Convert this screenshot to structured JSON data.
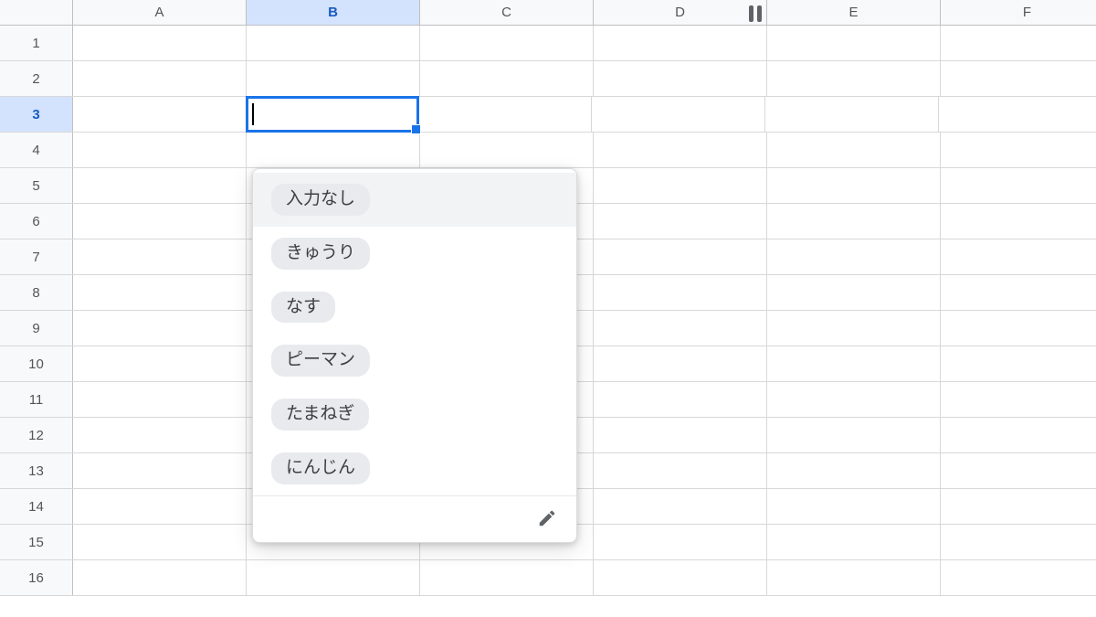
{
  "columns": [
    "A",
    "B",
    "C",
    "D",
    "E",
    "F"
  ],
  "active_column_index": 1,
  "rows": [
    1,
    2,
    3,
    4,
    5,
    6,
    7,
    8,
    9,
    10,
    11,
    12,
    13,
    14,
    15,
    16
  ],
  "active_row_index": 2,
  "dropdown": {
    "options": [
      {
        "label": "入力なし"
      },
      {
        "label": "きゅうり"
      },
      {
        "label": "なす"
      },
      {
        "label": "ピーマン"
      },
      {
        "label": "たまねぎ"
      },
      {
        "label": "にんじん"
      }
    ],
    "highlighted_index": 0
  }
}
